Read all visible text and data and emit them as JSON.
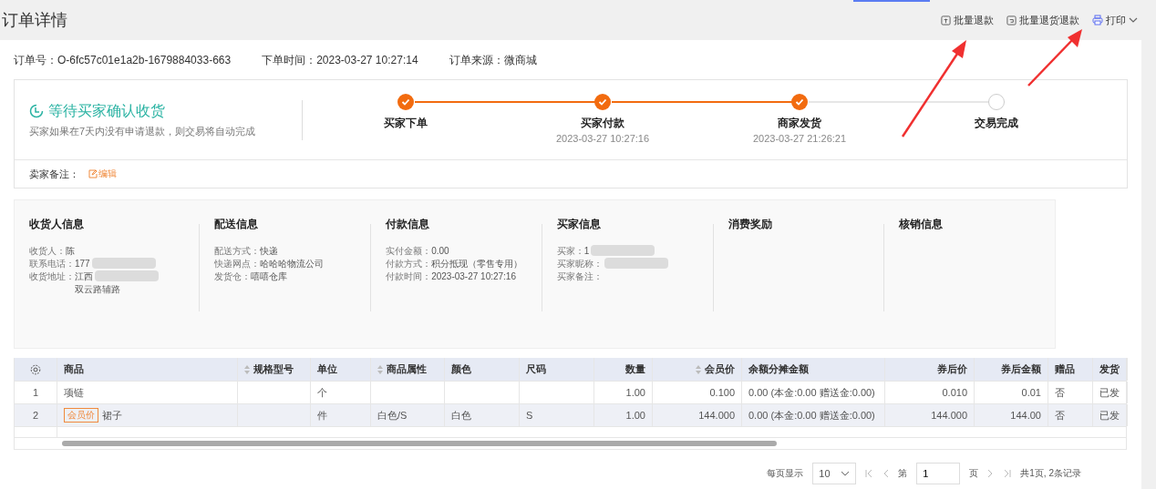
{
  "page": {
    "title": "订单详情"
  },
  "actions": [
    {
      "kind": "refund",
      "label": "批量退款"
    },
    {
      "kind": "return",
      "label": "批量退货退款"
    },
    {
      "kind": "print",
      "label": "打印"
    }
  ],
  "order_meta": [
    {
      "label": "订单号：",
      "value": "O-6fc57c01e1a2b-1679884033-663"
    },
    {
      "label": "下单时间：",
      "value": "2023-03-27 10:27:14"
    },
    {
      "label": "订单来源：",
      "value": "微商城"
    }
  ],
  "status": {
    "title": "等待买家确认收货",
    "description": "买家如果在7天内没有申请退款，则交易将自动完成"
  },
  "steps": [
    {
      "label": "买家下单",
      "done": true
    },
    {
      "label": "买家付款",
      "time": "2023-03-27 10:27:16",
      "done": true
    },
    {
      "label": "商家发货",
      "time": "2023-03-27 21:26:21",
      "done": true
    },
    {
      "label": "交易完成",
      "done": false
    }
  ],
  "seller_note": {
    "label": "卖家备注：",
    "edit": "编辑"
  },
  "info_sections": [
    {
      "title": "收货人信息",
      "lines": [
        {
          "label": "收货人：",
          "value": "陈"
        },
        {
          "label": "联系电话：",
          "value": "177",
          "redacted": true
        },
        {
          "label": "收货地址：",
          "value": "江西",
          "redacted": true,
          "tail": "双云路辅路"
        }
      ]
    },
    {
      "title": "配送信息",
      "lines": [
        {
          "label": "配送方式：",
          "value": "快递"
        },
        {
          "label": "快递网点：",
          "value": "哈哈哈物流公司"
        },
        {
          "label": "发货仓：",
          "value": "嘻嘻仓库"
        }
      ]
    },
    {
      "title": "付款信息",
      "lines": [
        {
          "label": "实付金额：",
          "value": "0.00"
        },
        {
          "label": "付款方式：",
          "value": "积分抵现（零售专用）"
        },
        {
          "label": "付款时间：",
          "value": "2023-03-27 10:27:16"
        }
      ]
    },
    {
      "title": "买家信息",
      "lines": [
        {
          "label": "买家：",
          "value": "1",
          "redacted": true
        },
        {
          "label": "买家昵称：",
          "redacted": true
        },
        {
          "label": "买家备注："
        }
      ]
    },
    {
      "title": "消费奖励"
    },
    {
      "title": "核销信息"
    }
  ],
  "table": {
    "columns": [
      {
        "label": "商品",
        "sortable": false,
        "kind": "text"
      },
      {
        "label": "规格型号",
        "sortable": true,
        "kind": "text"
      },
      {
        "label": "单位",
        "sortable": false,
        "kind": "text"
      },
      {
        "label": "商品属性",
        "sortable": true,
        "kind": "text"
      },
      {
        "label": "颜色",
        "sortable": false,
        "kind": "text"
      },
      {
        "label": "尺码",
        "sortable": false,
        "kind": "text"
      },
      {
        "label": "数量",
        "sortable": false,
        "kind": "number"
      },
      {
        "label": "会员价",
        "sortable": true,
        "kind": "number"
      },
      {
        "label": "余额分摊金额",
        "sortable": false,
        "kind": "text"
      },
      {
        "label": "券后价",
        "sortable": false,
        "kind": "number"
      },
      {
        "label": "券后金额",
        "sortable": false,
        "kind": "number"
      },
      {
        "label": "赠品",
        "sortable": false,
        "kind": "text"
      },
      {
        "label": "发货",
        "sortable": false,
        "kind": "text"
      }
    ],
    "rows": [
      {
        "index": "1",
        "selected": false,
        "cells": [
          "项链",
          "",
          "个",
          "",
          "",
          "",
          "1.00",
          "0.100",
          "0.00 (本金:0.00 赠送金:0.00)",
          "0.010",
          "0.01",
          "否",
          "已发"
        ]
      },
      {
        "index": "2",
        "tag": "会员价",
        "selected": true,
        "cells": [
          "裙子",
          "",
          "件",
          "白色/S",
          "白色",
          "S",
          "1.00",
          "144.000",
          "0.00 (本金:0.00 赠送金:0.00)",
          "144.000",
          "144.00",
          "否",
          "已发"
        ]
      }
    ]
  },
  "pagination": {
    "per_page_label": "每页显示",
    "per_page": "10",
    "page_prefix": "第",
    "page": "1",
    "page_suffix": "页",
    "summary": "共1页, 2条记录"
  }
}
